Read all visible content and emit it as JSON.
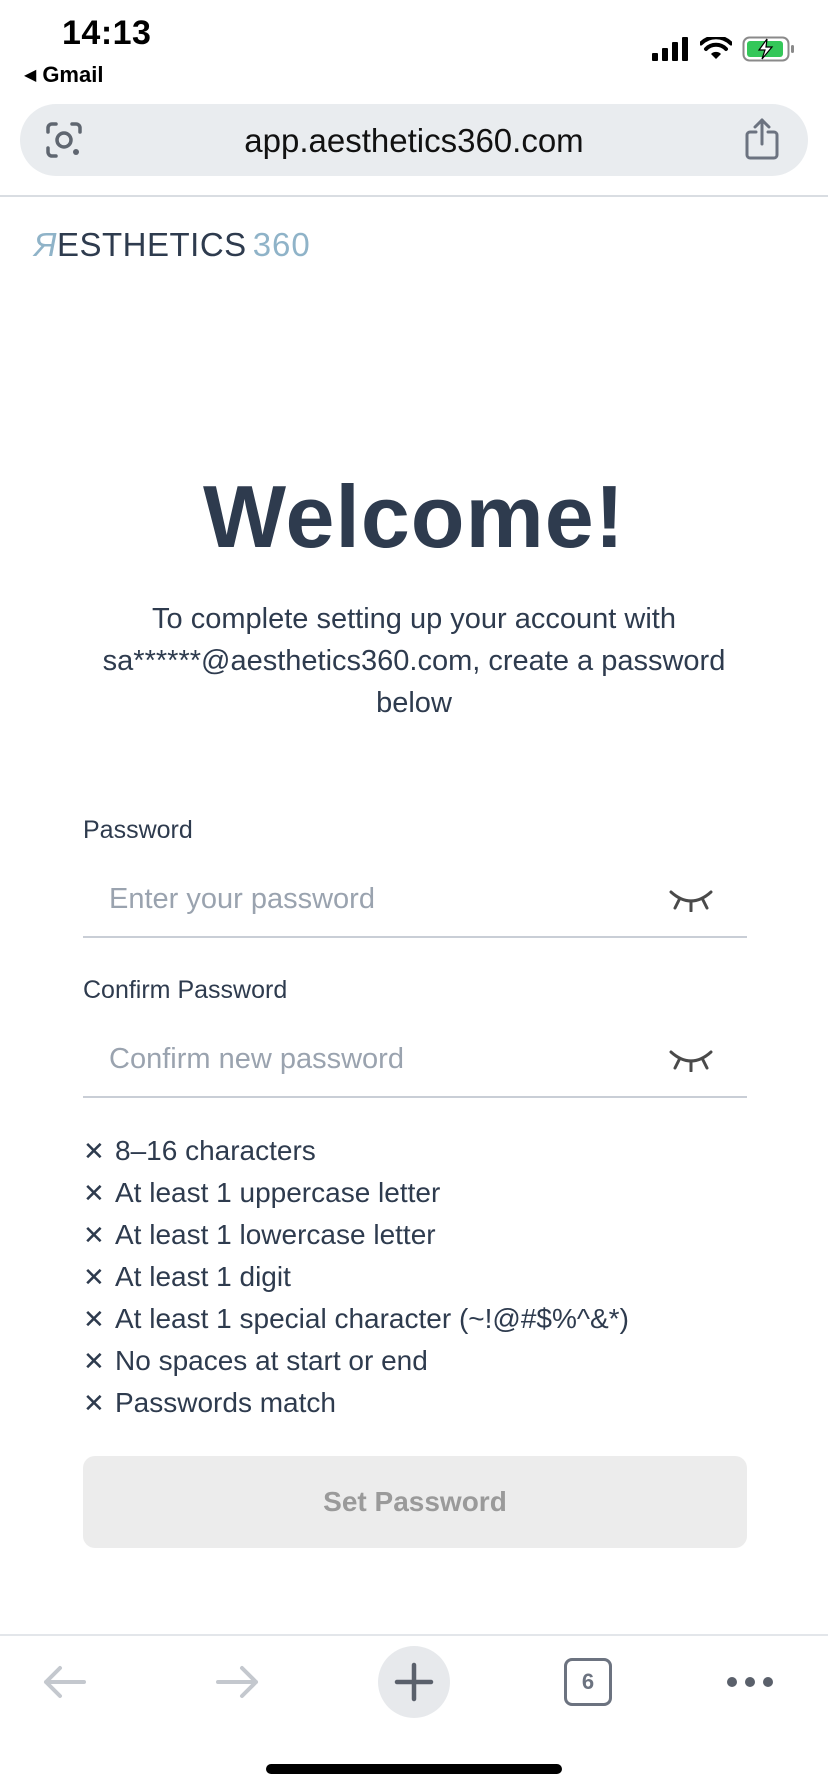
{
  "status_bar": {
    "time": "14:13",
    "back_app": "Gmail",
    "icons": [
      "signal-icon",
      "wifi-icon",
      "battery-charging-icon"
    ]
  },
  "browser": {
    "url": "app.aesthetics360.com",
    "tab_count": "6"
  },
  "logo": {
    "letter_a": "Я",
    "main": "ESTHETICS",
    "number": "360"
  },
  "welcome": {
    "title": "Welcome!",
    "line1": "To complete setting up your account with",
    "line2": "sa******@aesthetics360.com, create a password",
    "line3": "below"
  },
  "form": {
    "password_label": "Password",
    "password_placeholder": "Enter your password",
    "confirm_label": "Confirm Password",
    "confirm_placeholder": "Confirm new password"
  },
  "requirements": [
    "8–16 characters",
    "At least 1 uppercase letter",
    "At least 1 lowercase letter",
    "At least 1 digit",
    "At least 1 special character (~!@#$%^&*)",
    "No spaces at start or end",
    "Passwords match"
  ],
  "requirement_mark": "✕",
  "button": {
    "set_password": "Set Password"
  },
  "colors": {
    "text_primary": "#2e3b4e",
    "accent_logo": "#8fb3c8",
    "button_disabled_bg": "#ececec",
    "button_disabled_text": "#9a9a9a",
    "input_border": "#c9ced6"
  }
}
